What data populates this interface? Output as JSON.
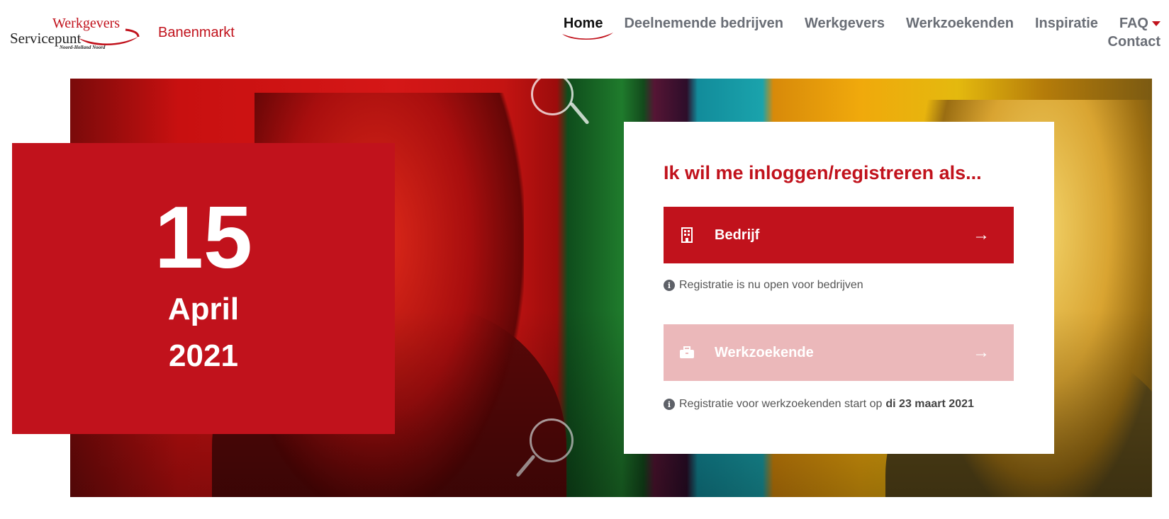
{
  "header": {
    "logo": {
      "line1": "Werkgevers",
      "line2": "Servicepunt",
      "line3": "Noord-Holland Noord"
    },
    "brand": "Banenmarkt"
  },
  "nav": {
    "items": [
      {
        "label": "Home",
        "active": true
      },
      {
        "label": "Deelnemende bedrijven"
      },
      {
        "label": "Werkgevers"
      },
      {
        "label": "Werkzoekenden"
      },
      {
        "label": "Inspiratie"
      },
      {
        "label": "FAQ",
        "dropdown": true
      },
      {
        "label": "Contact"
      }
    ]
  },
  "date_card": {
    "day": "15",
    "month": "April",
    "year": "2021"
  },
  "login": {
    "title": "Ik wil me inloggen/registreren als...",
    "company_button": {
      "label": "Bedrijf",
      "icon": "building-icon",
      "arrow": "→"
    },
    "company_note": "Registratie is nu open voor bedrijven",
    "jobseeker_button": {
      "label": "Werkzoekende",
      "icon": "briefcase-icon",
      "arrow": "→",
      "disabled": true
    },
    "jobseeker_note_prefix": "Registratie voor werkzoekenden start op",
    "jobseeker_note_date": "di 23 maart 2021",
    "info_icon": "info-icon"
  },
  "colors": {
    "brand_red": "#c1121c",
    "disabled_red": "#ebb8ba",
    "nav_gray": "#6a6e76"
  }
}
